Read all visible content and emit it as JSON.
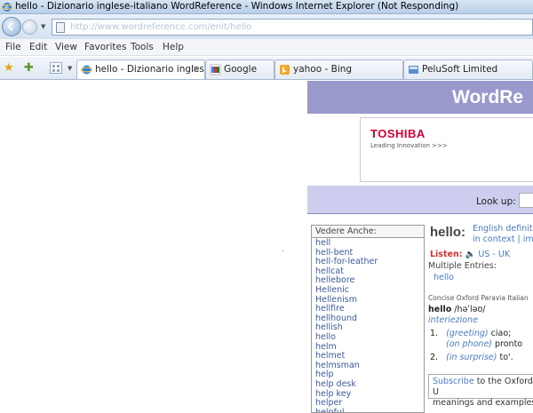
{
  "window": {
    "title": "hello - Dizionario inglese-italiano WordReference - Windows Internet Explorer (Not Responding)"
  },
  "address": {
    "url": "http://www.wordreference.com/enit/hello"
  },
  "menu": [
    "File",
    "Edit",
    "View",
    "Favorites",
    "Tools",
    "Help"
  ],
  "tabs": [
    {
      "label": "hello - Dizionario ingles...",
      "active": true,
      "close": "×"
    },
    {
      "label": "Google",
      "active": false
    },
    {
      "label": "yahoo - Bing",
      "active": false
    },
    {
      "label": "PeluSoft Limited",
      "active": false
    }
  ],
  "wr": {
    "logo": "WordRe",
    "ad": {
      "brand": "TOSHIBA",
      "tagline": "Leading Innovation >>>"
    },
    "lookup_label": "Look up:",
    "see_also": {
      "heading": "Vedere Anche:",
      "items": [
        "hell",
        "hell-bent",
        "hell-for-leather",
        "hellcat",
        "hellebore",
        "Hellenic",
        "Hellenism",
        "hellfire",
        "hellhound",
        "hellish",
        "hello",
        "helm",
        "helmet",
        "helmsman",
        "help",
        "help desk",
        "help key",
        "helper",
        "helpful"
      ]
    },
    "entry": {
      "headword": "hello:",
      "def_links": [
        "English definiti",
        "in context | imag"
      ],
      "listen_label": "Listen:",
      "speaker_icon": "speaker-icon",
      "listen_options": "US - UK",
      "multiple_entries": "Multiple Entries:",
      "multi_link": "hello",
      "source": "Concise Oxford Paravia Italian",
      "pron_word": "hello",
      "pron": "/həˈləʊ/",
      "pos": "interiezione",
      "sense1_num": "1.",
      "sense1_gloss": "(greeting)",
      "sense1_tr": " ciao;",
      "sense1b_gloss": "(on phone)",
      "sense1b_tr": " pronto",
      "sense2_num": "2.",
      "sense2_gloss": "(in surprise)",
      "sense2_tr": " to'.",
      "subscribe_link": "Subscribe",
      "subscribe_rest": " to the Oxford U",
      "subscribe_line2": "meanings and examples"
    }
  },
  "colors": {
    "wr_purple": "#9999cc",
    "wr_lavender": "#cdcdef",
    "link_blue": "#4a7bc0",
    "toshiba_red": "#cc0033"
  }
}
